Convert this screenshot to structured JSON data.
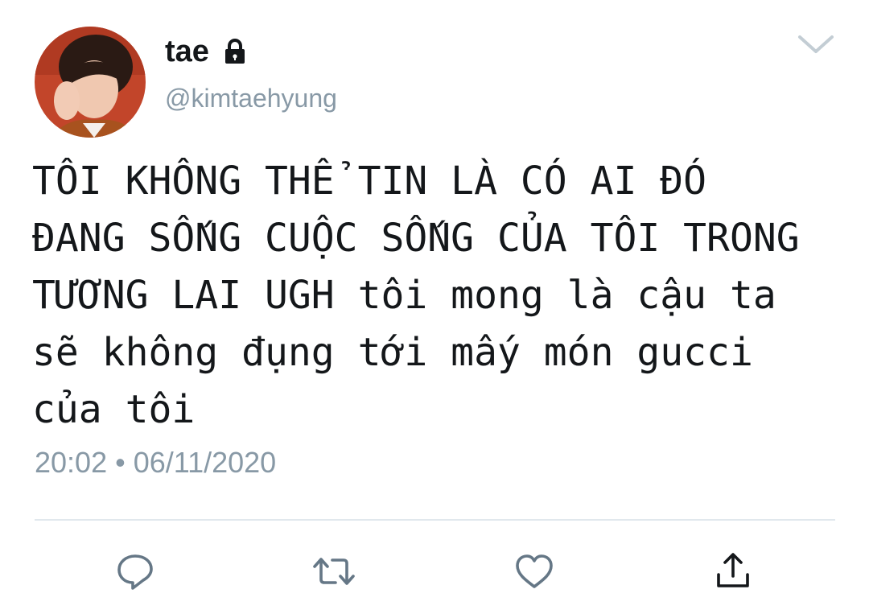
{
  "user": {
    "display_name": "tae",
    "handle": "@kimtaehyung",
    "avatar_icon": "profile-photo",
    "protected_icon": "lock-icon"
  },
  "menu": {
    "icon": "chevron-down-icon"
  },
  "tweet": {
    "text": "TÔI KHÔNG THỂ TIN LÀ CÓ AI ĐÓ\nĐANG SỐNG CUỘC SỐNG CỦA TÔI TRONG\nTƯƠNG LAI UGH tôi mong là cậu ta\nsẽ không đụng tới mấy món gucci\ncủa tôi",
    "timestamp": "20:02 • 06/11/2020"
  },
  "actions": [
    {
      "name": "reply",
      "icon": "reply-icon"
    },
    {
      "name": "retweet",
      "icon": "retweet-icon"
    },
    {
      "name": "like",
      "icon": "heart-icon"
    },
    {
      "name": "share",
      "icon": "share-icon"
    }
  ],
  "colors": {
    "text": "#14171a",
    "secondary": "#8899a6",
    "divider": "#e1e8ed",
    "icon": "#657786"
  }
}
